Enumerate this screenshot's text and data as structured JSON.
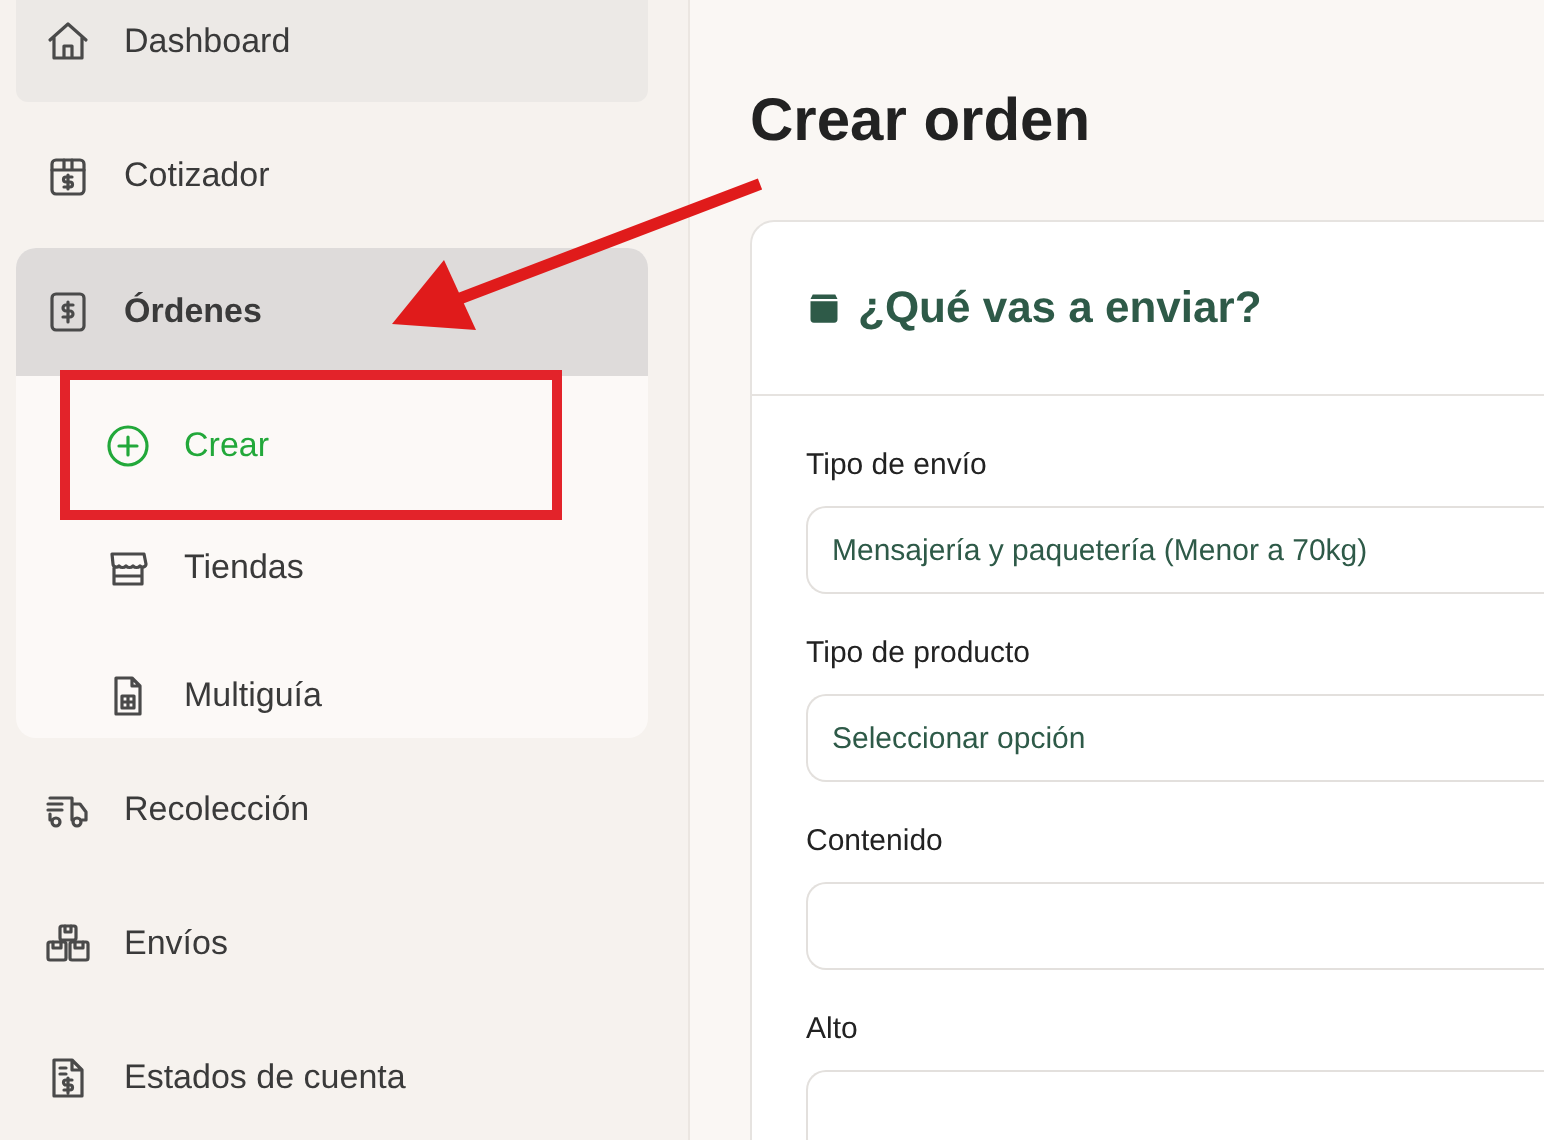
{
  "sidebar": {
    "items": [
      {
        "kind": "link",
        "label": "Dashboard",
        "selected": true
      },
      {
        "kind": "link",
        "label": "Cotizador",
        "selected": false
      },
      {
        "kind": "group",
        "label": "Órdenes",
        "expanded": true,
        "children": [
          {
            "label": "Crear",
            "selected": true
          },
          {
            "label": "Tiendas",
            "selected": false
          },
          {
            "label": "Multiguía",
            "selected": false
          }
        ]
      },
      {
        "kind": "link",
        "label": "Recolección",
        "selected": false
      },
      {
        "kind": "link",
        "label": "Envíos",
        "selected": false
      },
      {
        "kind": "link",
        "label": "Estados de cuenta",
        "selected": false
      }
    ]
  },
  "page": {
    "title": "Crear orden"
  },
  "card": {
    "title": "¿Qué vas a enviar?",
    "fields": [
      {
        "label": "Tipo de envío",
        "value": "Mensajería y paquetería (Menor a 70kg)"
      },
      {
        "label": "Tipo de producto",
        "value": "Seleccionar opción"
      },
      {
        "label": "Contenido"
      },
      {
        "label": "Alto"
      }
    ]
  }
}
